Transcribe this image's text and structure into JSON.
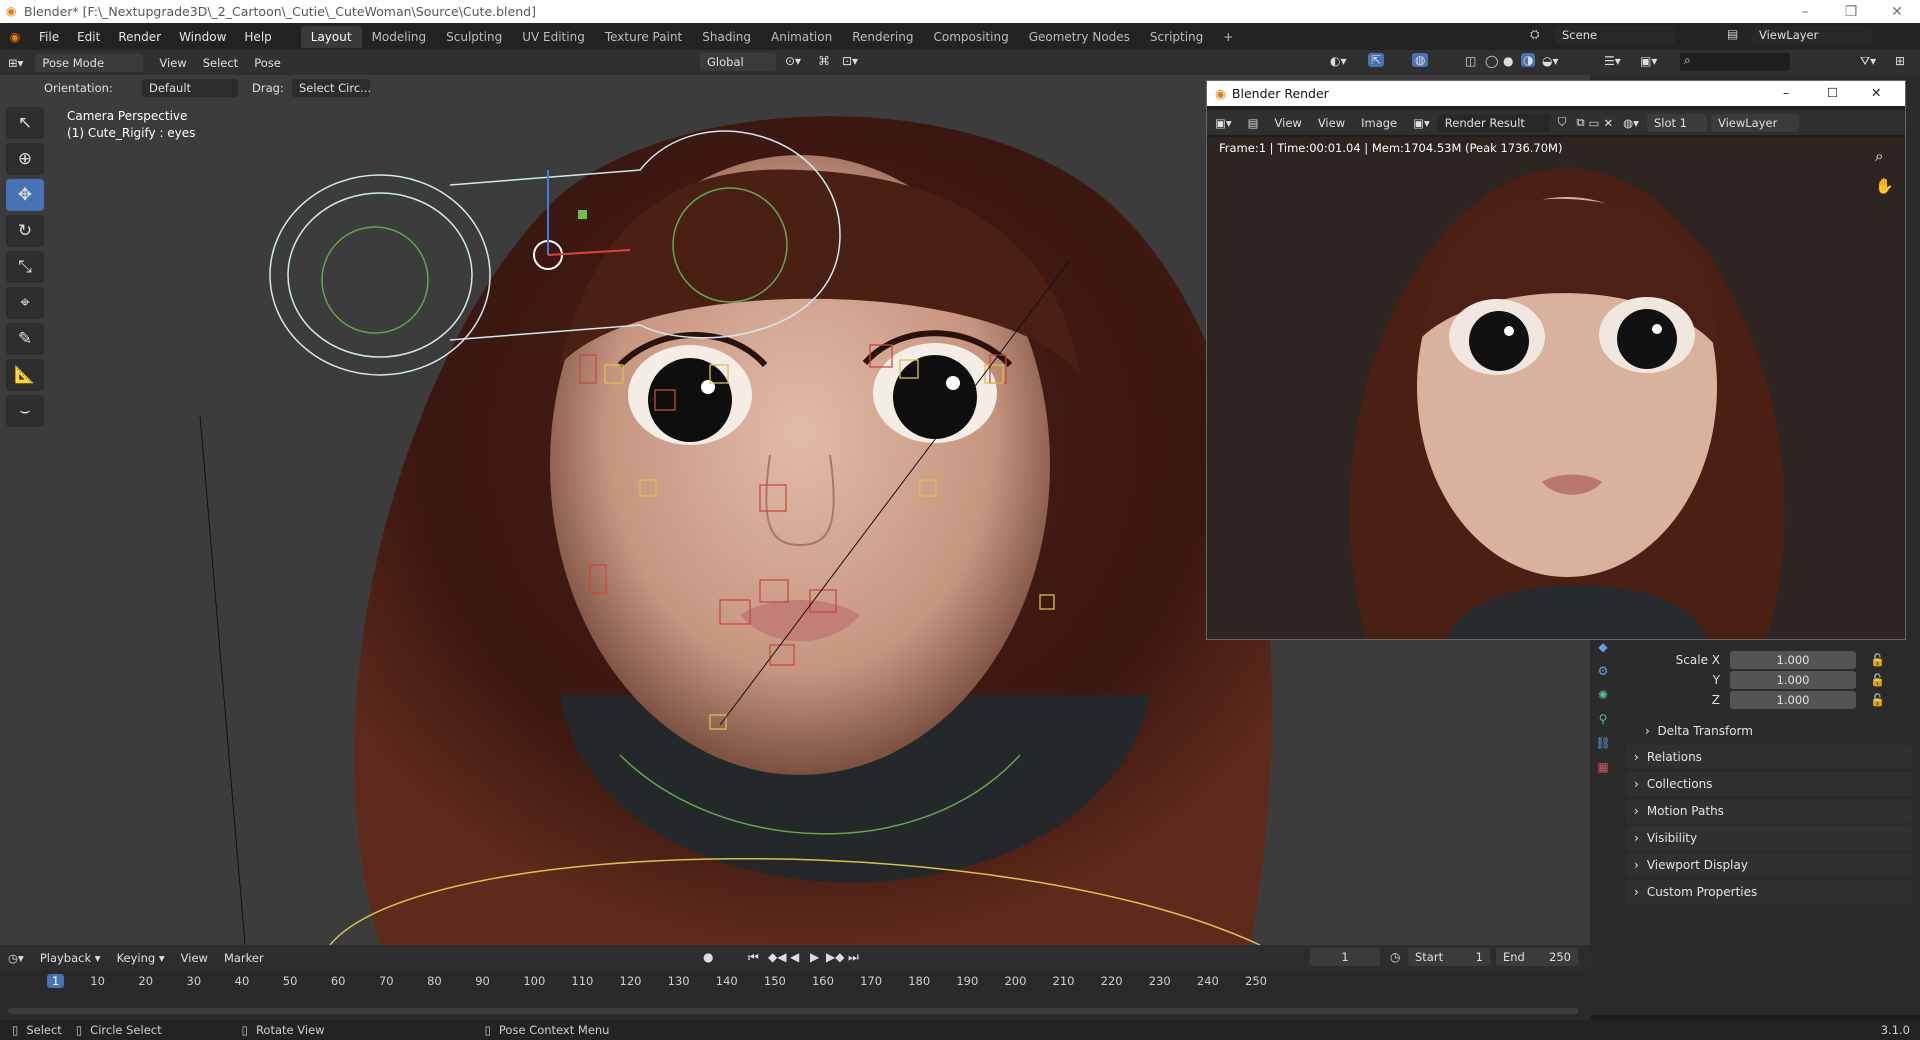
{
  "titlebar": {
    "title": "Blender* [F:\\_Nextupgrade3D\\_2_Cartoon\\_Cutie\\_CuteWoman\\Source\\Cute.blend]"
  },
  "menu": {
    "items": [
      "File",
      "Edit",
      "Render",
      "Window",
      "Help"
    ]
  },
  "workspaces": {
    "tabs": [
      "Layout",
      "Modeling",
      "Sculpting",
      "UV Editing",
      "Texture Paint",
      "Shading",
      "Animation",
      "Rendering",
      "Compositing",
      "Geometry Nodes",
      "Scripting"
    ],
    "add": "+"
  },
  "topright": {
    "scene": "Scene",
    "view_layer": "ViewLayer"
  },
  "header3d": {
    "mode": "Pose Mode",
    "view": "View",
    "select": "Select",
    "pose": "Pose",
    "orientation_global": "Global"
  },
  "toolsettings": {
    "orientation_label": "Orientation:",
    "orientation_value": "Default",
    "drag_label": "Drag:",
    "drag_value": "Select Circ..."
  },
  "viewport": {
    "camera": "Camera Perspective",
    "object": "(1) Cute_Rigify : eyes"
  },
  "render_window": {
    "title": "Blender Render",
    "view": "View",
    "view2": "View",
    "image": "Image",
    "result": "Render Result",
    "slot": "Slot 1",
    "layer": "ViewLayer",
    "info": "Frame:1 | Time:00:01.04 | Mem:1704.53M (Peak 1736.70M)"
  },
  "properties": {
    "scale_x_label": "Scale X",
    "scale_x": "1.000",
    "y_label": "Y",
    "y": "1.000",
    "z_label": "Z",
    "z": "1.000",
    "delta": "Delta Transform",
    "panels": [
      "Relations",
      "Collections",
      "Motion Paths",
      "Visibility",
      "Viewport Display",
      "Custom Properties"
    ]
  },
  "timeline": {
    "playback": "Playback",
    "keying": "Keying",
    "view": "View",
    "marker": "Marker",
    "current": "1",
    "start_label": "Start",
    "start": "1",
    "end_label": "End",
    "end": "250",
    "ticks": [
      "1",
      "10",
      "20",
      "30",
      "40",
      "50",
      "60",
      "70",
      "80",
      "90",
      "100",
      "110",
      "120",
      "130",
      "140",
      "150",
      "160",
      "170",
      "180",
      "190",
      "200",
      "210",
      "220",
      "230",
      "240",
      "250"
    ]
  },
  "status": {
    "select": "Select",
    "circle": "Circle Select",
    "rotate": "Rotate View",
    "context": "Pose Context Menu",
    "version": "3.1.0"
  }
}
